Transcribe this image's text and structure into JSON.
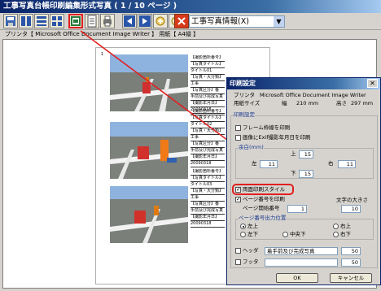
{
  "window": {
    "title": "工事写真台帳印刷編集形式写真 ( 1 / 10 ページ )"
  },
  "toolbar": {
    "dropdown_value": "工事写真情報(X)"
  },
  "infobar": {
    "printer_label": "プリンタ【 Microsoft Office Document Image Writer 】 用紙【 A4縦 】"
  },
  "paper": {
    "page_number": "1",
    "entries": [
      [
        "【撮影箇所番号】",
        "【写真タイトル】",
        "タイトル01",
        "【写真・大分類】",
        "工事",
        "【写真区分】番",
        "手前及び完成写真",
        "【撮影年月日】",
        "20090318"
      ],
      [
        "【撮影箇所番号】",
        "【写真タイトル】",
        "タイトル02",
        "【写真・大分類】",
        "工事",
        "【写真区分】番",
        "手前及び完成写真",
        "【撮影年月日】",
        "20090318"
      ],
      [
        "【撮影箇所番号】",
        "【写真タイトル】",
        "タイトル03",
        "【写真・大分類】",
        "工事",
        "【写真区分】番",
        "手前及び完成写真",
        "【撮影年月日】",
        "20090318"
      ]
    ]
  },
  "dialog": {
    "title": "印刷設定",
    "printer_label": "プリンタ",
    "printer_name": "Microsoft Office Document Image Writer",
    "paper_size_label": "用紙サイズ",
    "width_label": "幅",
    "width_value": "210 mm",
    "height_label": "高さ",
    "height_value": "297 mm",
    "print_settings_label": "印刷設定",
    "frame_border": "フレーム枠線を印刷",
    "exif_date": "画像にExif撮影年月日を印刷",
    "margin_label": "余白(mm)",
    "top_label": "上",
    "top_value": "15",
    "left_label": "左",
    "left_value": "11",
    "right_label": "右",
    "right_value": "11",
    "bottom_label": "下",
    "bottom_value": "15",
    "duplex_style": "両面印刷スタイル",
    "page_number_print": "ページ番号を印刷",
    "font_size_label": "文字の大きさ",
    "page_start_label": "ページ開始番号",
    "page_start_value": "1",
    "font_size_value": "10",
    "page_pos_label": "ページ番号出力位置",
    "pos_top_left": "左上",
    "pos_top_right": "右上",
    "pos_bottom_left": "左下",
    "pos_bottom_center": "中央下",
    "pos_bottom_right": "右下",
    "header_label": "ヘッダ",
    "header_value": "着手前及び完成写真",
    "header_size": "50",
    "footer_label": "フッタ",
    "footer_value": "",
    "footer_size": "50",
    "ok_label": "OK",
    "cancel_label": "キャンセル"
  },
  "colors": {
    "accent_red": "#e02020",
    "title_blue": "#0a246a"
  }
}
